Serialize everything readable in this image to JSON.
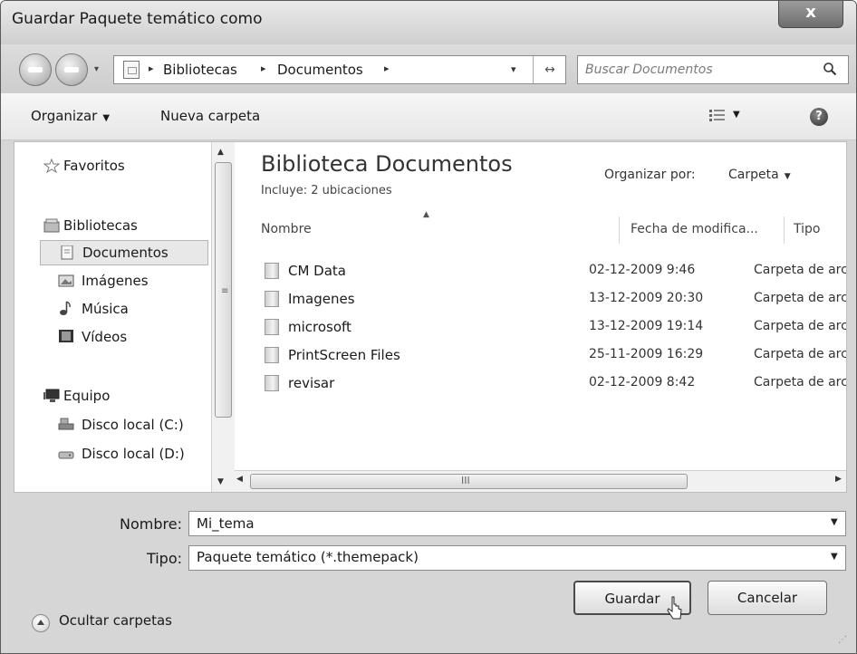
{
  "window": {
    "title": "Guardar Paquete temático como",
    "close_label": "x"
  },
  "address_bar": {
    "crumbs": [
      "Bibliotecas",
      "Documentos"
    ],
    "separator": "▸",
    "dropdown": "▾",
    "refresh_glyph": "↔"
  },
  "search": {
    "placeholder": "Buscar Documentos"
  },
  "toolbar": {
    "organize_label": "Organizar",
    "new_folder_label": "Nueva carpeta",
    "help_glyph": "?"
  },
  "nav": {
    "favorites": "Favoritos",
    "libraries": "Bibliotecas",
    "documents": "Documentos",
    "images": "Imágenes",
    "music": "Música",
    "videos": "Vídeos",
    "computer": "Equipo",
    "disk_c": "Disco local (C:)",
    "disk_d": "Disco local (D:)"
  },
  "library": {
    "title": "Biblioteca Documentos",
    "subtitle": "Incluye: 2 ubicaciones",
    "arrange_label": "Organizar por:",
    "arrange_value": "Carpeta"
  },
  "columns": {
    "name": "Nombre",
    "date": "Fecha de modifica...",
    "type": "Tipo"
  },
  "files": [
    {
      "name": "CM Data",
      "date": "02-12-2009 9:46",
      "type": "Carpeta de archivos"
    },
    {
      "name": "Imagenes",
      "date": "13-12-2009 20:30",
      "type": "Carpeta de archivos"
    },
    {
      "name": "microsoft",
      "date": "13-12-2009 19:14",
      "type": "Carpeta de archivos"
    },
    {
      "name": "PrintScreen Files",
      "date": "25-11-2009 16:29",
      "type": "Carpeta de archivos"
    },
    {
      "name": "revisar",
      "date": "02-12-2009 8:42",
      "type": "Carpeta de archivos"
    }
  ],
  "form": {
    "name_label": "Nombre:",
    "name_value": "Mi_tema",
    "type_label": "Tipo:",
    "type_value": "Paquete temático (*.themepack)"
  },
  "footer": {
    "hide_folders": "Ocultar carpetas",
    "save_label": "Guardar",
    "cancel_label": "Cancelar"
  },
  "icons": {
    "favorites": "star-icon",
    "libraries": "library-icon",
    "documents": "document-icon",
    "images": "picture-icon",
    "music": "music-note-icon",
    "videos": "film-icon",
    "computer": "computer-icon",
    "disk": "hard-drive-icon",
    "folder": "folder-icon"
  }
}
